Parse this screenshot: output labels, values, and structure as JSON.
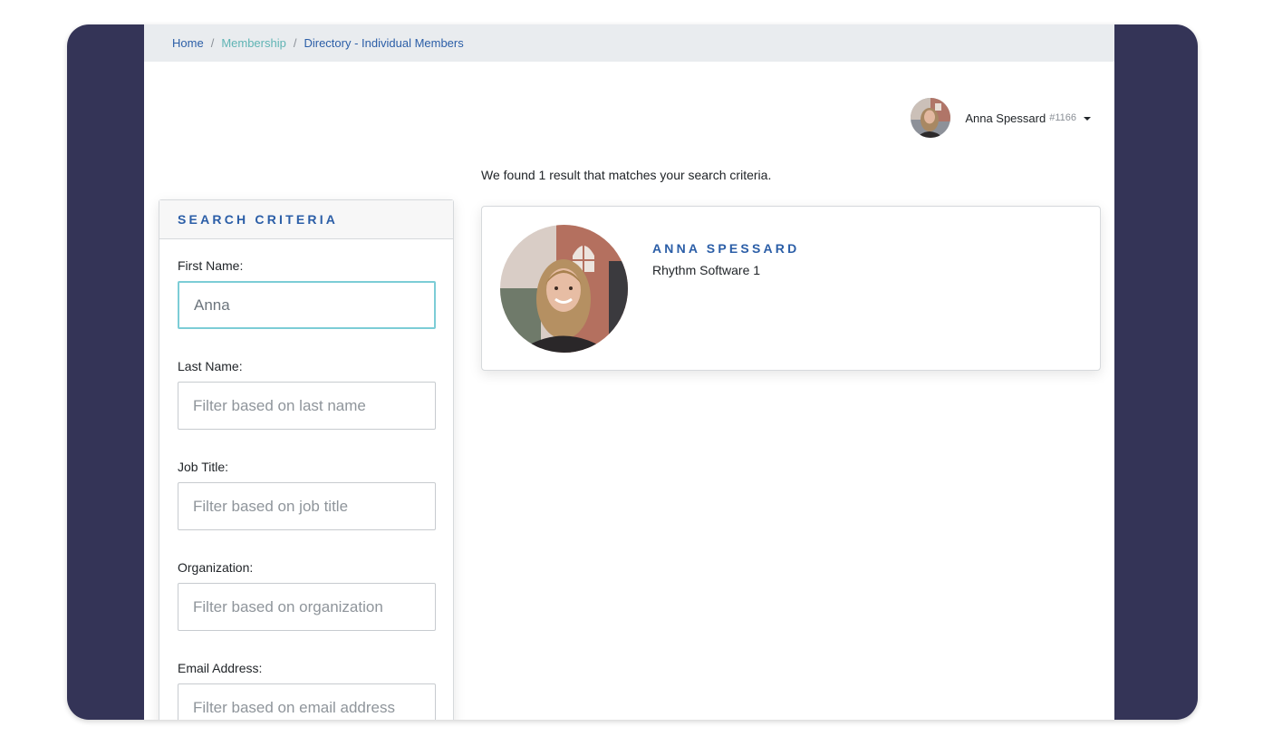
{
  "breadcrumb": {
    "items": [
      "Home",
      "Membership",
      "Directory - Individual Members"
    ],
    "separator": "/"
  },
  "user": {
    "name": "Anna Spessard",
    "id": "#1166",
    "avatar_icon": "user-avatar-photo"
  },
  "results": {
    "message": "We found 1 result that matches your search criteria."
  },
  "search": {
    "title": "SEARCH CRITERIA",
    "fields": {
      "first_name": {
        "label": "First Name:",
        "value": "Anna",
        "placeholder": ""
      },
      "last_name": {
        "label": "Last Name:",
        "value": "",
        "placeholder": "Filter based on last name"
      },
      "job_title": {
        "label": "Job Title:",
        "value": "",
        "placeholder": "Filter based on job title"
      },
      "organization": {
        "label": "Organization:",
        "value": "",
        "placeholder": "Filter based on organization"
      },
      "email": {
        "label": "Email Address:",
        "value": "",
        "placeholder": "Filter based on email address"
      }
    }
  },
  "member": {
    "name": "ANNA SPESSARD",
    "organization": "Rhythm Software 1"
  },
  "colors": {
    "frame": "#343457",
    "accent": "#2b5ea7",
    "breadcrumb_active": "#5fb4b4",
    "focus_border": "#7ccdd6"
  }
}
